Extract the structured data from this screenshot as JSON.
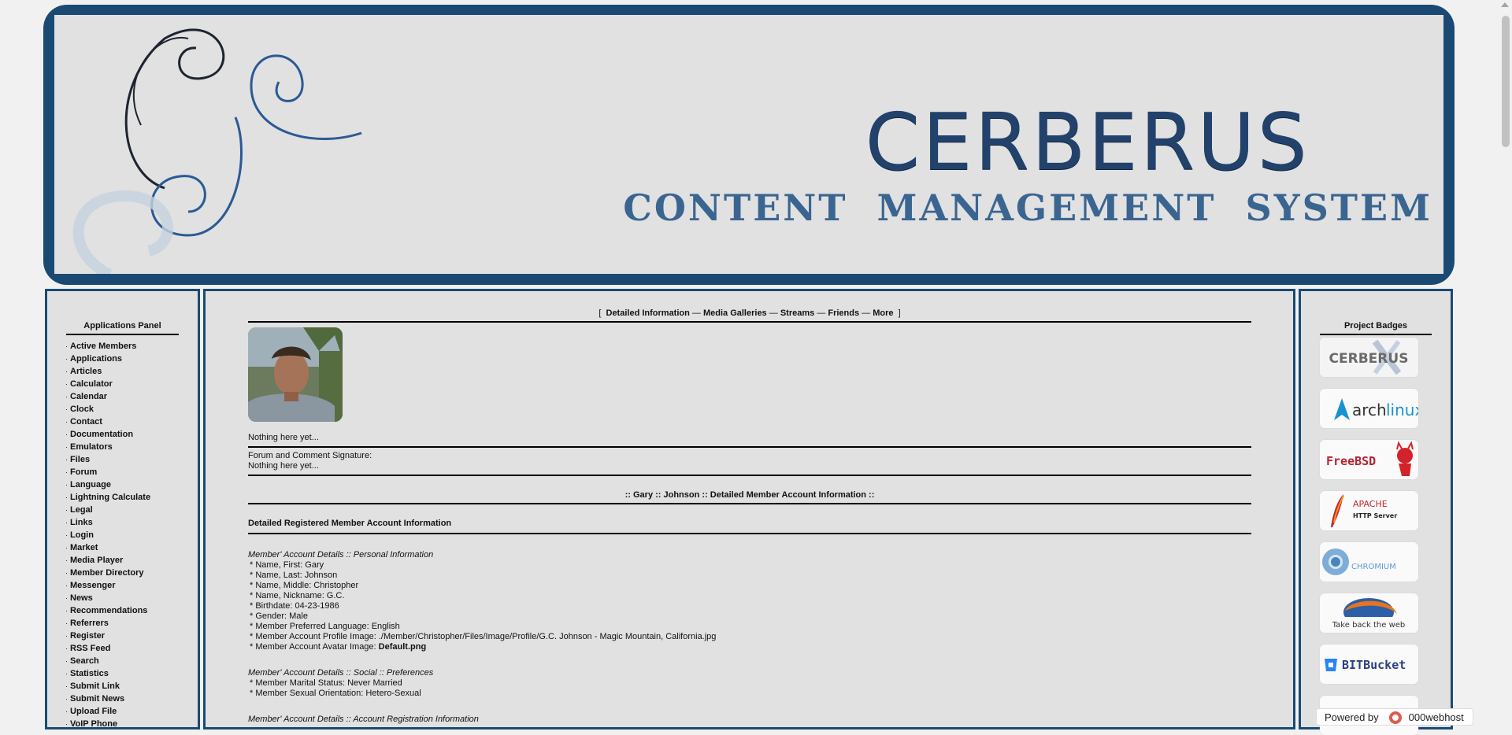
{
  "banner": {
    "title": "CERBERUS",
    "subtitle": "CONTENT MANAGEMENT SYSTEM"
  },
  "left_panel": {
    "title": "Applications Panel",
    "bullet": "·",
    "items": [
      "Active Members",
      "Applications",
      "Articles",
      "Calculator",
      "Calendar",
      "Clock",
      "Contact",
      "Documentation",
      "Emulators",
      "Files",
      "Forum",
      "Language",
      "Lightning Calculate",
      "Legal",
      "Links",
      "Login",
      "Market",
      "Media Player",
      "Member Directory",
      "Messenger",
      "News",
      "Recommendations",
      "Referrers",
      "Register",
      "RSS Feed",
      "Search",
      "Statistics",
      "Submit Link",
      "Submit News",
      "Upload File",
      "VoIP Phone"
    ]
  },
  "main": {
    "tabs_open": "[",
    "tabs_close": "]",
    "separator": "—",
    "tabs": [
      "Detailed Information",
      "Media Galleries",
      "Streams",
      "Friends",
      "More"
    ],
    "about_text": "Nothing here yet...",
    "signature_label": "Forum and Comment Signature:",
    "signature_text": "Nothing here yet...",
    "account_heading": ":: Gary :: Johnson :: Detailed Member Account Information ::",
    "registered_heading": "Detailed Registered Member Account Information",
    "personal_title": "Member' Account Details :: Personal Information",
    "personal": [
      " * Name, First: Gary",
      " * Name, Last: Johnson",
      " * Name, Middle: Christopher",
      " * Name, Nickname: G.C.",
      " * Birthdate: 04-23-1986",
      " * Gender: Male",
      " * Member Preferred Language: English",
      " * Member Account Profile Image: ./Member/Christopher/Files/Image/Profile/G.C. Johnson - Magic Mountain, California.jpg"
    ],
    "avatar_image_label": " * Member Account Avatar Image: ",
    "avatar_image_value": "Default.png",
    "social_title": "Member' Account Details :: Social :: Preferences",
    "social": [
      " * Member Marital Status: Never Married",
      " * Member Sexual Orientation: Hetero-Sexual"
    ],
    "registration_title": "Member' Account Details :: Account Registration Information"
  },
  "right_panel": {
    "title": "Project Badges",
    "badges": [
      {
        "name": "cerberus",
        "text": "CERBERUS"
      },
      {
        "name": "archlinux",
        "text_a": "arch",
        "text_b": "linux"
      },
      {
        "name": "freebsd",
        "text": "FreeBSD"
      },
      {
        "name": "apache",
        "text_a": "APACHE",
        "text_b": "HTTP Server"
      },
      {
        "name": "chromium",
        "text": "CHROMIUM"
      },
      {
        "name": "firefox",
        "text": "Take back the web"
      },
      {
        "name": "bitbucket",
        "text": "BITBucket"
      }
    ]
  },
  "footer": {
    "powered_by": "Powered by",
    "host": "000webhost"
  },
  "colors": {
    "frame": "#1a4a74",
    "panel_bg": "#e1e1e1",
    "page_bg": "#f1f1f1"
  }
}
